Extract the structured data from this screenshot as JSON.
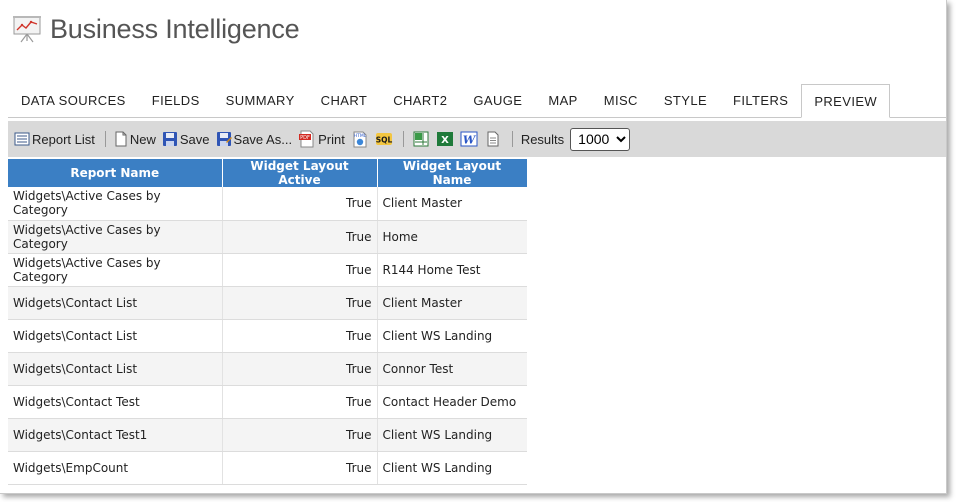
{
  "app": {
    "title": "Business Intelligence",
    "icon": "presentation-board-icon"
  },
  "tabs": [
    {
      "label": "DATA SOURCES",
      "active": false
    },
    {
      "label": "FIELDS",
      "active": false
    },
    {
      "label": "SUMMARY",
      "active": false
    },
    {
      "label": "CHART",
      "active": false
    },
    {
      "label": "CHART2",
      "active": false
    },
    {
      "label": "GAUGE",
      "active": false
    },
    {
      "label": "MAP",
      "active": false
    },
    {
      "label": "MISC",
      "active": false
    },
    {
      "label": "STYLE",
      "active": false
    },
    {
      "label": "FILTERS",
      "active": false
    },
    {
      "label": "PREVIEW",
      "active": true
    }
  ],
  "toolbar": {
    "report_list": "Report List",
    "new": "New",
    "save": "Save",
    "save_as": "Save As...",
    "print": "Print",
    "results_label": "Results",
    "results_value": "1000"
  },
  "table": {
    "headers": [
      "Report Name",
      "Widget Layout Active",
      "Widget Layout Name"
    ],
    "rows": [
      [
        "Widgets\\Active Cases by Category",
        "True",
        "Client Master"
      ],
      [
        "Widgets\\Active Cases by Category",
        "True",
        "Home"
      ],
      [
        "Widgets\\Active Cases by Category",
        "True",
        "R144 Home Test"
      ],
      [
        "Widgets\\Contact List",
        "True",
        "Client Master"
      ],
      [
        "Widgets\\Contact List",
        "True",
        "Client WS Landing"
      ],
      [
        "Widgets\\Contact List",
        "True",
        "Connor Test"
      ],
      [
        "Widgets\\Contact Test",
        "True",
        "Contact Header Demo"
      ],
      [
        "Widgets\\Contact Test1",
        "True",
        "Client WS Landing"
      ],
      [
        "Widgets\\EmpCount",
        "True",
        "Client WS Landing"
      ]
    ]
  },
  "colors": {
    "header_blue": "#3b7fc4",
    "toolbar_gray": "#d9d9d9"
  }
}
